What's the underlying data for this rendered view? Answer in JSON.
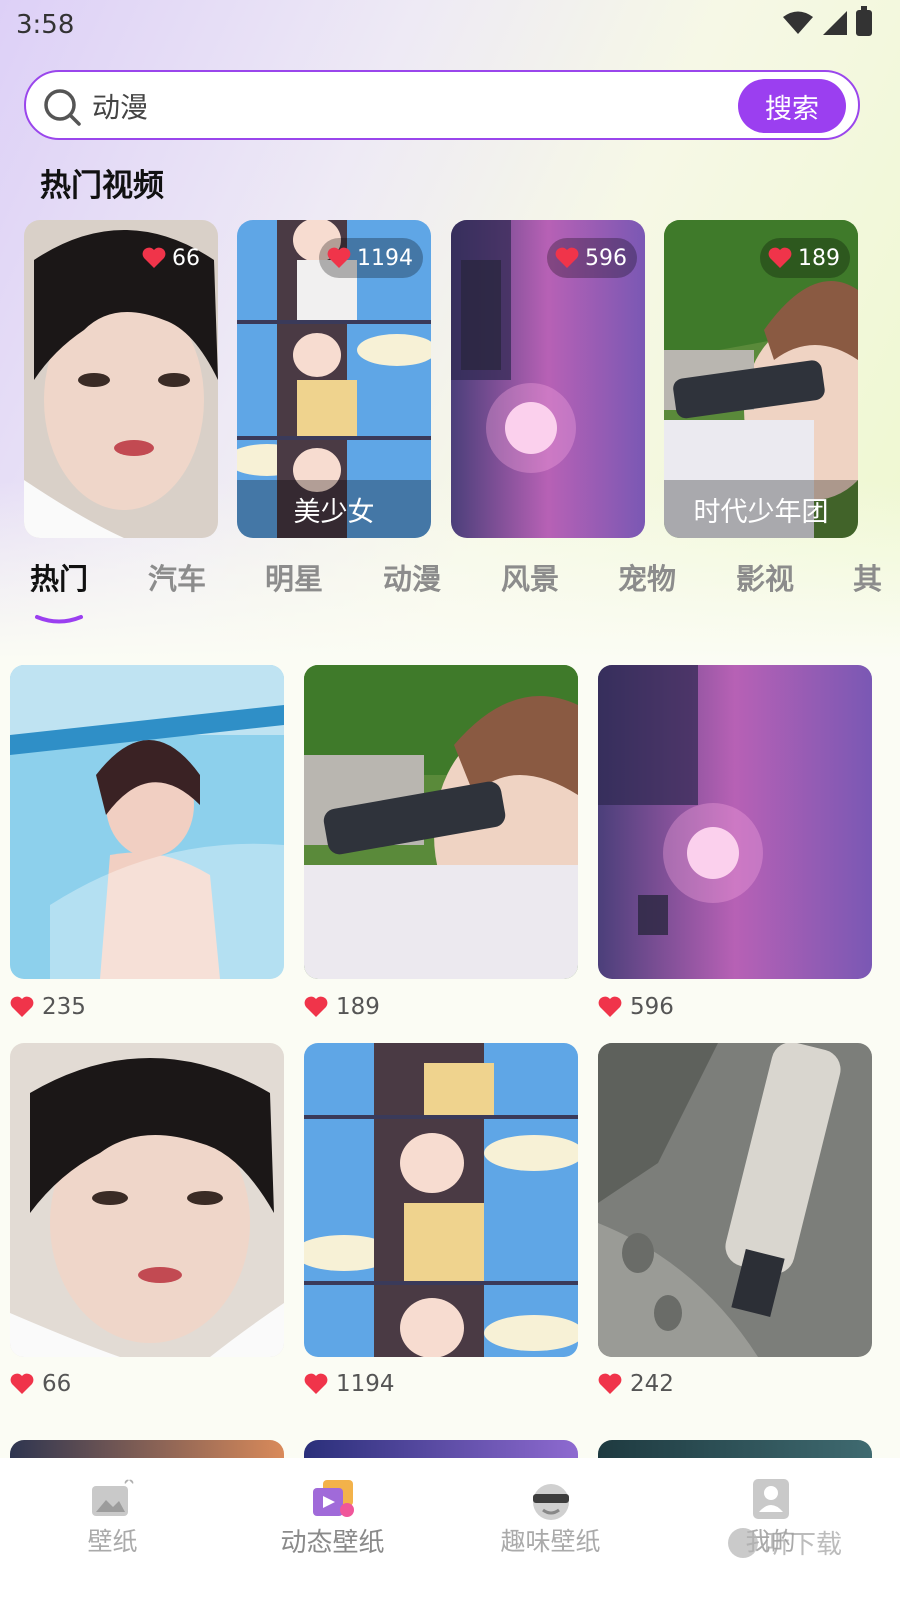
{
  "status_bar": {
    "time": "3:58"
  },
  "search": {
    "value": "动漫",
    "button_label": "搜索"
  },
  "hot_section": {
    "title": "热门视频",
    "cards": [
      {
        "likes": "66",
        "caption": "",
        "thumb": "short-hair-girl"
      },
      {
        "likes": "1194",
        "caption": "美少女",
        "thumb": "anime-girl"
      },
      {
        "likes": "596",
        "caption": "",
        "thumb": "anime-sunset"
      },
      {
        "likes": "189",
        "caption": "时代少年团",
        "thumb": "boy-camera"
      }
    ]
  },
  "tabs": [
    "热门",
    "汽车",
    "明星",
    "动漫",
    "风景",
    "宠物",
    "影视",
    "其"
  ],
  "active_tab": "热门",
  "grid": [
    {
      "likes": "235",
      "thumb": "pool-girl"
    },
    {
      "likes": "189",
      "thumb": "boy-camera"
    },
    {
      "likes": "596",
      "thumb": "anime-sunset"
    },
    {
      "likes": "66",
      "thumb": "short-hair-girl"
    },
    {
      "likes": "1194",
      "thumb": "anime-girl"
    },
    {
      "likes": "242",
      "thumb": "anime-ruins"
    }
  ],
  "bottom_nav": [
    {
      "label": "壁纸",
      "icon": "wallpaper-icon"
    },
    {
      "label": "动态壁纸",
      "icon": "live-wallpaper-icon"
    },
    {
      "label": "趣味壁纸",
      "icon": "fun-wallpaper-icon"
    },
    {
      "label": "我的",
      "icon": "profile-icon"
    }
  ],
  "watermark": "听下载",
  "colors": {
    "accent": "#9b3ff0",
    "heart": "#f0344a"
  }
}
